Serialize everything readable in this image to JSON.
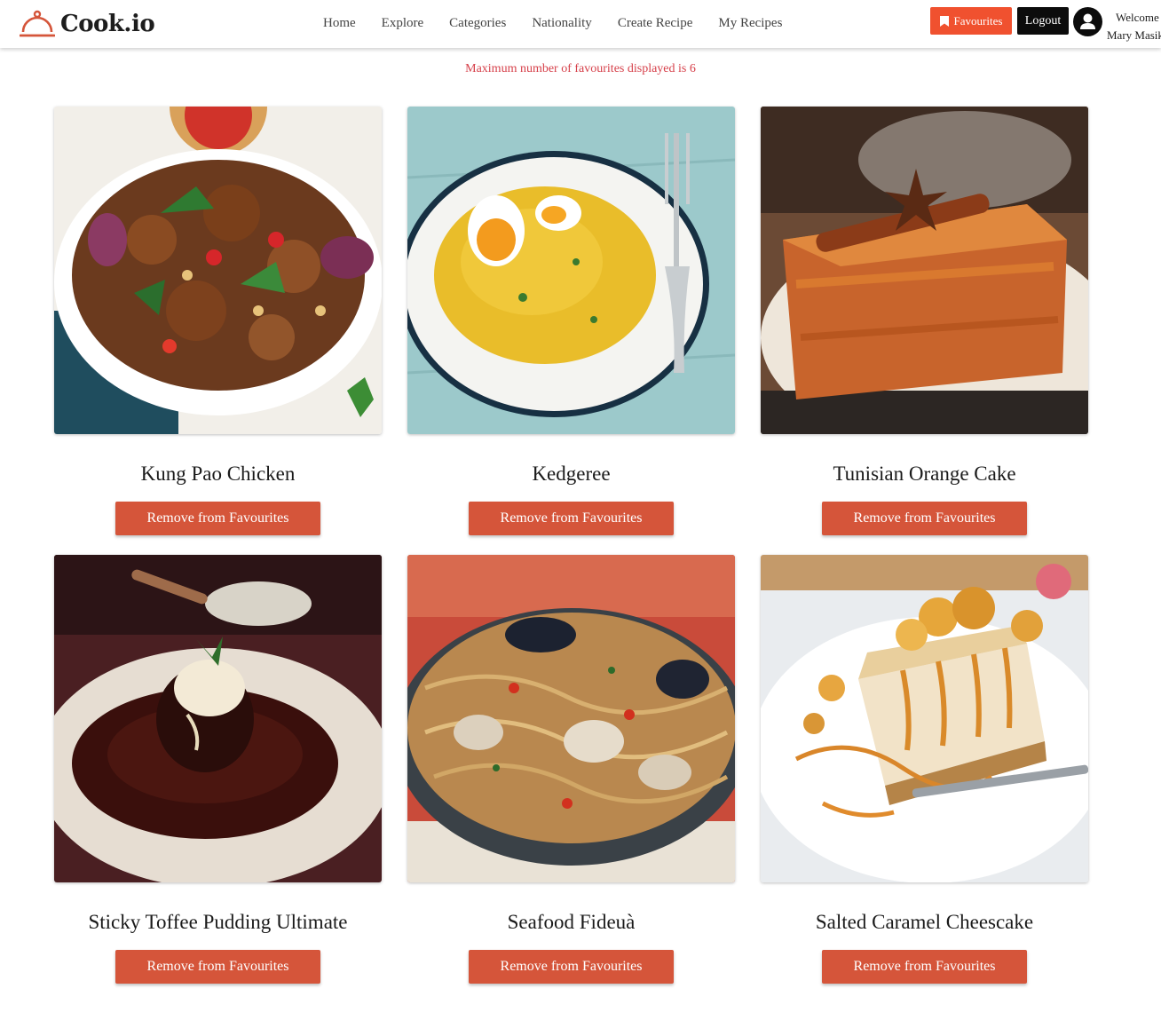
{
  "brand": {
    "name": "Cook.io",
    "logo_icon": "cloche-icon",
    "accent": "#d5553a"
  },
  "nav": {
    "items": [
      "Home",
      "Explore",
      "Categories",
      "Nationality",
      "Create Recipe",
      "My Recipes"
    ]
  },
  "header_actions": {
    "favourites_label": "Favourites",
    "favourites_icon": "bookmark-icon",
    "favourites_color": "#f0512f",
    "logout_label": "Logout",
    "avatar_icon": "user-icon",
    "welcome_line1": "Welcome",
    "welcome_line2": "Mary Masika"
  },
  "notice": {
    "text": "Maximum number of favourites displayed is 6",
    "color": "#d6404a"
  },
  "favourites": [
    {
      "title": "Kung Pao Chicken",
      "button": "Remove from Favourites",
      "image": "kung-pao-chicken-photo"
    },
    {
      "title": "Kedgeree",
      "button": "Remove from Favourites",
      "image": "kedgeree-photo"
    },
    {
      "title": "Tunisian Orange Cake",
      "button": "Remove from Favourites",
      "image": "tunisian-orange-cake-photo"
    },
    {
      "title": "Sticky Toffee Pudding Ultimate",
      "button": "Remove from Favourites",
      "image": "sticky-toffee-pudding-photo"
    },
    {
      "title": "Seafood Fideuà",
      "button": "Remove from Favourites",
      "image": "seafood-fideua-photo"
    },
    {
      "title": "Salted Caramel Cheescake",
      "button": "Remove from Favourites",
      "image": "salted-caramel-cheesecake-photo"
    }
  ]
}
